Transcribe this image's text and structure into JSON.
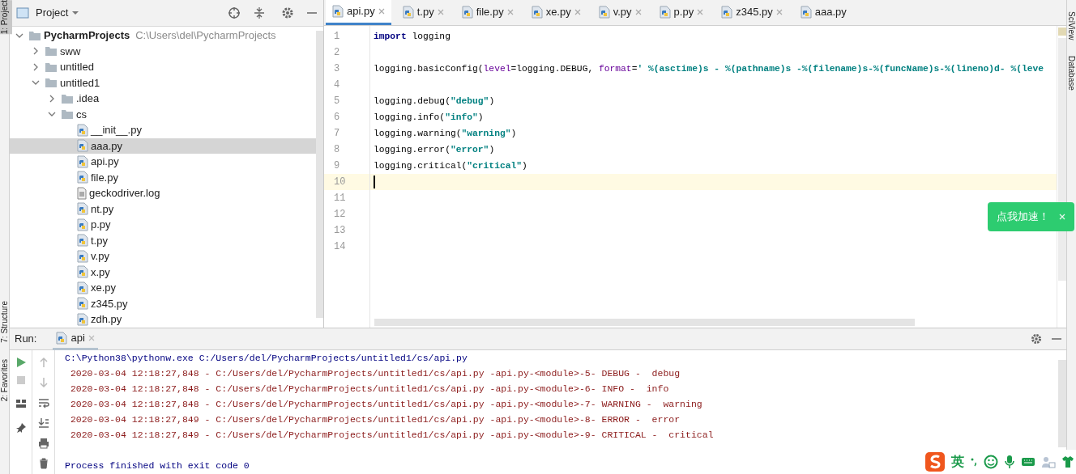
{
  "left_strip": [
    {
      "label": "1: Project",
      "selected": true
    },
    {
      "label": "7: Structure",
      "selected": false
    },
    {
      "label": "2: Favorites",
      "selected": false
    }
  ],
  "right_strip": [
    {
      "label": "SciView"
    },
    {
      "label": "Database"
    }
  ],
  "project_panel": {
    "title": "Project",
    "tree": [
      {
        "name": "PycharmProjects",
        "path": "C:\\Users\\del\\PycharmProjects",
        "kind": "root",
        "expanded": true,
        "selected": false,
        "children": [
          {
            "name": "sww",
            "kind": "folder",
            "expanded": false,
            "selected": false
          },
          {
            "name": "untitled",
            "kind": "folder",
            "expanded": false,
            "selected": false
          },
          {
            "name": "untitled1",
            "kind": "folder",
            "expanded": true,
            "selected": false,
            "children": [
              {
                "name": ".idea",
                "kind": "folder",
                "expanded": false,
                "selected": false
              },
              {
                "name": "cs",
                "kind": "folder",
                "expanded": true,
                "selected": false,
                "children": [
                  {
                    "name": "__init__.py",
                    "kind": "py",
                    "selected": false
                  },
                  {
                    "name": "aaa.py",
                    "kind": "py",
                    "selected": true
                  },
                  {
                    "name": "api.py",
                    "kind": "py",
                    "selected": false
                  },
                  {
                    "name": "file.py",
                    "kind": "py",
                    "selected": false
                  },
                  {
                    "name": "geckodriver.log",
                    "kind": "log",
                    "selected": false
                  },
                  {
                    "name": "nt.py",
                    "kind": "py",
                    "selected": false
                  },
                  {
                    "name": "p.py",
                    "kind": "py",
                    "selected": false
                  },
                  {
                    "name": "t.py",
                    "kind": "py",
                    "selected": false
                  },
                  {
                    "name": "v.py",
                    "kind": "py",
                    "selected": false
                  },
                  {
                    "name": "x.py",
                    "kind": "py",
                    "selected": false
                  },
                  {
                    "name": "xe.py",
                    "kind": "py",
                    "selected": false
                  },
                  {
                    "name": "z345.py",
                    "kind": "py",
                    "selected": false
                  },
                  {
                    "name": "zdh.py",
                    "kind": "py",
                    "selected": false
                  }
                ]
              }
            ]
          }
        ]
      }
    ]
  },
  "editor_tabs": [
    {
      "label": "api.py",
      "selected": true,
      "closable": true
    },
    {
      "label": "t.py",
      "selected": false,
      "closable": true
    },
    {
      "label": "file.py",
      "selected": false,
      "closable": true
    },
    {
      "label": "xe.py",
      "selected": false,
      "closable": true
    },
    {
      "label": "v.py",
      "selected": false,
      "closable": true
    },
    {
      "label": "p.py",
      "selected": false,
      "closable": true
    },
    {
      "label": "z345.py",
      "selected": false,
      "closable": true
    },
    {
      "label": "aaa.py",
      "selected": false,
      "closable": false
    }
  ],
  "code_lines": [
    {
      "number": "1",
      "current": false,
      "segments": [
        {
          "kind": "keyword",
          "text": "import"
        },
        {
          "kind": "plain",
          "text": " logging"
        }
      ]
    },
    {
      "number": "2",
      "current": false
    },
    {
      "number": "3",
      "current": false,
      "segments": [
        {
          "kind": "plain",
          "text": "logging.basicConfig("
        },
        {
          "kind": "param",
          "text": "level"
        },
        {
          "kind": "plain",
          "text": "=logging.DEBUG, "
        },
        {
          "kind": "param",
          "text": "format"
        },
        {
          "kind": "plain",
          "text": "="
        },
        {
          "kind": "string",
          "text": "' %(asctime)s - %(pathname)s -%(filename)s-%(funcName)s-%(lineno)d- %(leve"
        }
      ]
    },
    {
      "number": "4",
      "current": false
    },
    {
      "number": "5",
      "current": false,
      "segments": [
        {
          "kind": "plain",
          "text": "logging.debug("
        },
        {
          "kind": "string",
          "text": "\"debug\""
        },
        {
          "kind": "plain",
          "text": ")"
        }
      ]
    },
    {
      "number": "6",
      "current": false,
      "segments": [
        {
          "kind": "plain",
          "text": "logging.info("
        },
        {
          "kind": "string",
          "text": "\"info\""
        },
        {
          "kind": "plain",
          "text": ")"
        }
      ]
    },
    {
      "number": "7",
      "current": false,
      "segments": [
        {
          "kind": "plain",
          "text": "logging.warning("
        },
        {
          "kind": "string",
          "text": "\"warning\""
        },
        {
          "kind": "plain",
          "text": ")"
        }
      ]
    },
    {
      "number": "8",
      "current": false,
      "segments": [
        {
          "kind": "plain",
          "text": "logging.error("
        },
        {
          "kind": "string",
          "text": "\"error\""
        },
        {
          "kind": "plain",
          "text": ")"
        }
      ]
    },
    {
      "number": "9",
      "current": false,
      "segments": [
        {
          "kind": "plain",
          "text": "logging.critical("
        },
        {
          "kind": "string",
          "text": "\"critical\""
        },
        {
          "kind": "plain",
          "text": ")"
        }
      ]
    },
    {
      "number": "10",
      "current": true
    },
    {
      "number": "11",
      "current": false
    },
    {
      "number": "12",
      "current": false
    },
    {
      "number": "13",
      "current": false
    },
    {
      "number": "14",
      "current": false
    }
  ],
  "toast": {
    "text": "点我加速！"
  },
  "run_panel": {
    "label": "Run:",
    "tab": "api",
    "console": [
      {
        "kind": "command",
        "text": "C:\\Python38\\pythonw.exe C:/Users/del/PycharmProjects/untitled1/cs/api.py"
      },
      {
        "kind": "log",
        "text": " 2020-03-04 12:18:27,848 - C:/Users/del/PycharmProjects/untitled1/cs/api.py -api.py-<module>-5- DEBUG -  debug"
      },
      {
        "kind": "log",
        "text": " 2020-03-04 12:18:27,848 - C:/Users/del/PycharmProjects/untitled1/cs/api.py -api.py-<module>-6- INFO -  info"
      },
      {
        "kind": "log",
        "text": " 2020-03-04 12:18:27,848 - C:/Users/del/PycharmProjects/untitled1/cs/api.py -api.py-<module>-7- WARNING -  warning"
      },
      {
        "kind": "log",
        "text": " 2020-03-04 12:18:27,849 - C:/Users/del/PycharmProjects/untitled1/cs/api.py -api.py-<module>-8- ERROR -  error"
      },
      {
        "kind": "log",
        "text": " 2020-03-04 12:18:27,849 - C:/Users/del/PycharmProjects/untitled1/cs/api.py -api.py-<module>-9- CRITICAL -  critical"
      },
      {
        "kind": "blank"
      },
      {
        "kind": "exit",
        "text": "Process finished with exit code 0"
      }
    ]
  },
  "ime_toolbar": {
    "language": "英"
  }
}
